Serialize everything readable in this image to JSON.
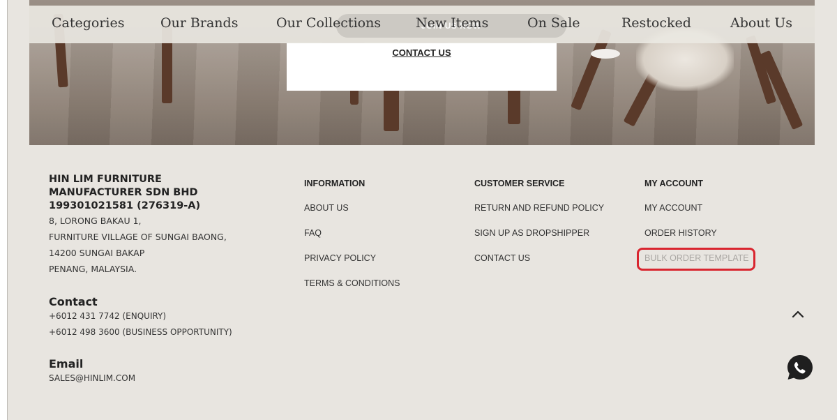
{
  "nav": {
    "items": [
      "Categories",
      "Our Brands",
      "Our Collections",
      "New Items",
      "On Sale",
      "Restocked",
      "About Us"
    ],
    "join_label": "JOIN US NOW"
  },
  "hero": {
    "contact_link": "CONTACT US"
  },
  "footer": {
    "company": {
      "name_line1": "HIN LIM FURNITURE",
      "name_line2": "MANUFACTURER SDN BHD",
      "reg_no": "199301021581 (276319-A)",
      "address": [
        "8, LORONG BAKAU 1,",
        "FURNITURE VILLAGE OF SUNGAI BAONG,",
        "14200 SUNGAI BAKAP",
        "PENANG, MALAYSIA."
      ]
    },
    "contact": {
      "title": "Contact",
      "lines": [
        "+6012 431 7742 (ENQUIRY)",
        "+6012 498 3600 (BUSINESS OPPORTUNITY)"
      ]
    },
    "email": {
      "title": "Email",
      "value": "SALES@HINLIM.COM"
    },
    "information": {
      "title": "INFORMATION",
      "links": [
        "ABOUT US",
        "FAQ",
        "PRIVACY POLICY",
        "TERMS & CONDITIONS"
      ]
    },
    "customer_service": {
      "title": "CUSTOMER SERVICE",
      "links": [
        "RETURN AND REFUND POLICY",
        "SIGN UP AS DROPSHIPPER",
        "CONTACT US"
      ]
    },
    "my_account": {
      "title": "MY ACCOUNT",
      "links": [
        "MY ACCOUNT",
        "ORDER HISTORY",
        "BULK ORDER TEMPLATE"
      ]
    }
  },
  "widgets": {
    "scroll_top_icon": "chevron-up-icon",
    "whatsapp_icon": "whatsapp-icon"
  },
  "colors": {
    "footer_bg": "#e8e5e0",
    "highlight": "#d9252f",
    "muted_link": "#aaa7a3"
  }
}
